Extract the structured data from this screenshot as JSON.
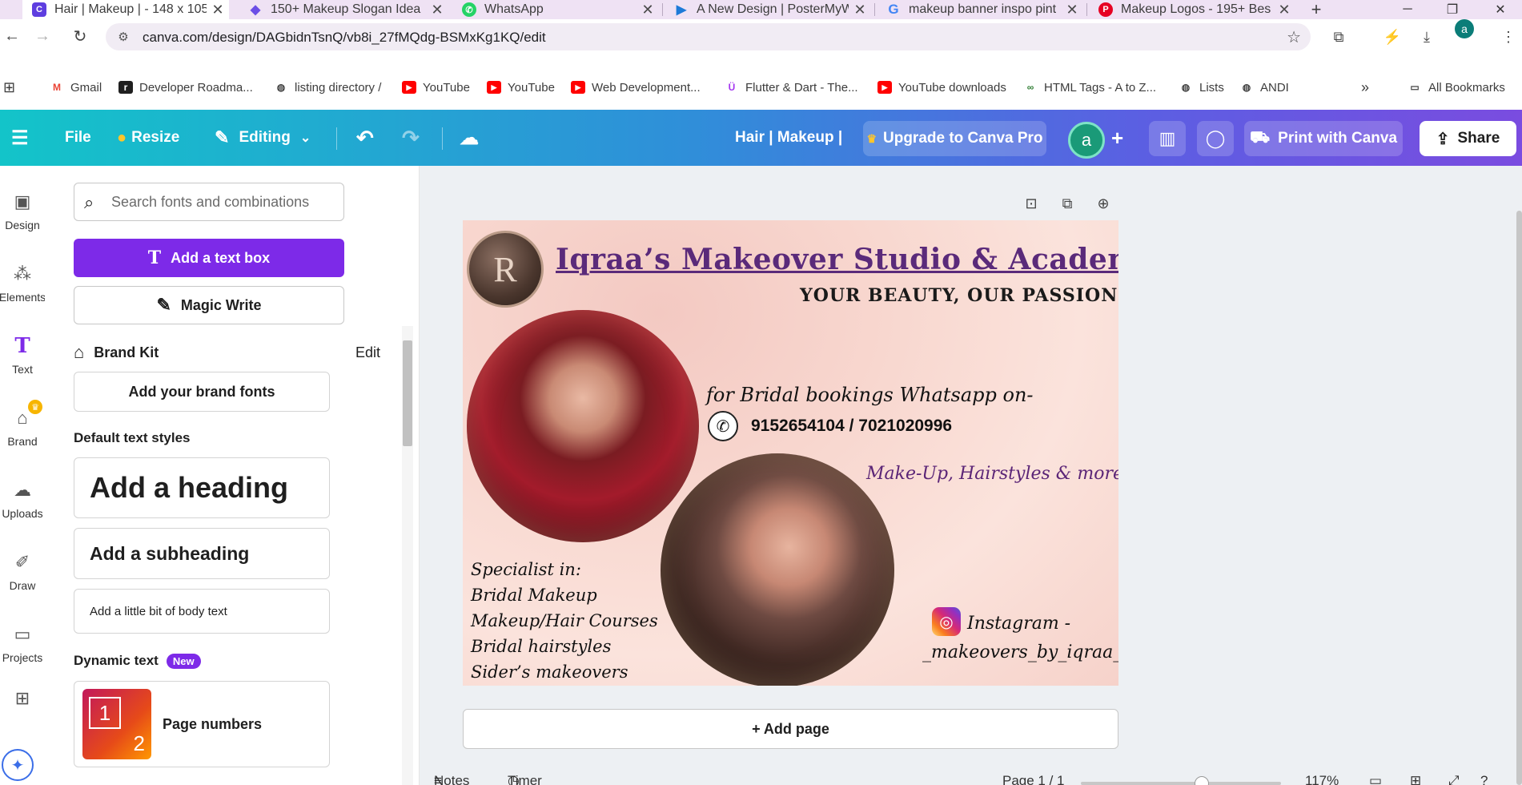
{
  "browser": {
    "tabs": [
      {
        "title": "Hair | Makeup | - 148 x 105",
        "icon": "canva-icon",
        "color": "#5e3ee0",
        "active": true
      },
      {
        "title": "150+ Makeup Slogan Idea",
        "icon": "diamond-icon",
        "color": "#6b4de6",
        "active": false
      },
      {
        "title": "WhatsApp",
        "icon": "whatsapp-icon",
        "color": "#25d366",
        "active": false
      },
      {
        "title": "A New Design | PosterMyW",
        "icon": "postermywall-icon",
        "color": "#1d7ad8",
        "active": false
      },
      {
        "title": "makeup banner inspo pint",
        "icon": "google-icon",
        "color": "#4285f4",
        "active": false
      },
      {
        "title": "Makeup Logos - 195+ Bes",
        "icon": "pinterest-icon",
        "color": "#e60023",
        "active": false
      }
    ],
    "new_tab_label": "+",
    "url": "canva.com/design/DAGbidnTsnQ/vb8i_27fMQdg-BSMxKg1KQ/edit",
    "profile_initial": "a",
    "bookmarks": [
      {
        "label": "Gmail",
        "icon": "gmail-icon"
      },
      {
        "label": "Developer Roadma...",
        "icon": "roadmap-icon"
      },
      {
        "label": "listing directory /",
        "icon": "globe-icon"
      },
      {
        "label": "YouTube",
        "icon": "youtube-icon"
      },
      {
        "label": "YouTube",
        "icon": "youtube-icon"
      },
      {
        "label": "Web Development...",
        "icon": "youtube-icon"
      },
      {
        "label": "Flutter & Dart - The...",
        "icon": "udemy-icon"
      },
      {
        "label": "YouTube downloads",
        "icon": "youtube-icon"
      },
      {
        "label": "HTML Tags - A to Z...",
        "icon": "link-icon"
      },
      {
        "label": "Lists",
        "icon": "globe-icon"
      },
      {
        "label": "ANDI",
        "icon": "globe-icon"
      }
    ],
    "more_label": "»",
    "all_bookmarks_label": "All Bookmarks"
  },
  "canva_header": {
    "file_label": "File",
    "resize_label": "Resize",
    "editing_label": "Editing",
    "design_title": "Hair | Makeup |",
    "upgrade_label": "Upgrade to Canva Pro",
    "avatar_initial": "a",
    "print_label": "Print with Canva",
    "share_label": "Share"
  },
  "rail": [
    {
      "label": "Design",
      "icon": "design-icon"
    },
    {
      "label": "Elements",
      "icon": "elements-icon"
    },
    {
      "label": "Text",
      "icon": "text-icon"
    },
    {
      "label": "Brand",
      "icon": "brand-icon"
    },
    {
      "label": "Uploads",
      "icon": "uploads-icon"
    },
    {
      "label": "Draw",
      "icon": "draw-icon"
    },
    {
      "label": "Projects",
      "icon": "projects-icon"
    },
    {
      "label": "",
      "icon": "apps-icon"
    }
  ],
  "panel": {
    "search_placeholder": "Search fonts and combinations",
    "add_text_box_label": "Add a text box",
    "magic_write_label": "Magic Write",
    "brand_kit_label": "Brand Kit",
    "brand_kit_edit": "Edit",
    "add_brand_fonts_label": "Add your brand fonts",
    "default_styles_title": "Default text styles",
    "heading_label": "Add a heading",
    "subheading_label": "Add a subheading",
    "body_label": "Add a little bit of body text",
    "dynamic_text_title": "Dynamic text",
    "new_badge": "New",
    "page_numbers_label": "Page numbers",
    "page_numbers_thumb": {
      "top": "1",
      "bottom": "2"
    }
  },
  "poster": {
    "logo_letter": "R",
    "title": "Iqraa’s Makeover Studio & Academy",
    "tagline": "YOUR BEAUTY, OUR PASSION",
    "bookings": "for Bridal bookings Whatsapp on-",
    "phones": "9152654104 / 7021020996",
    "services": "Make-Up, Hairstyles & more...",
    "specialist_lines": [
      "Specialist in:",
      "Bridal Makeup",
      "Makeup/Hair Courses",
      "Bridal hairstyles",
      "Sider’s makeovers"
    ],
    "instagram_label": "Instagram -",
    "instagram_handle": "_makeovers_by_iqraa_"
  },
  "canvas": {
    "add_page_label": "+ Add page"
  },
  "footer": {
    "notes_label": "Notes",
    "timer_label": "Timer",
    "page_label": "Page 1 / 1",
    "zoom_label": "117%"
  },
  "colors": {
    "accent_purple": "#7d2ae8",
    "poster_title": "#5a2a7a",
    "header_gradient_start": "#13c4c9",
    "header_gradient_end": "#7a4ce0"
  }
}
